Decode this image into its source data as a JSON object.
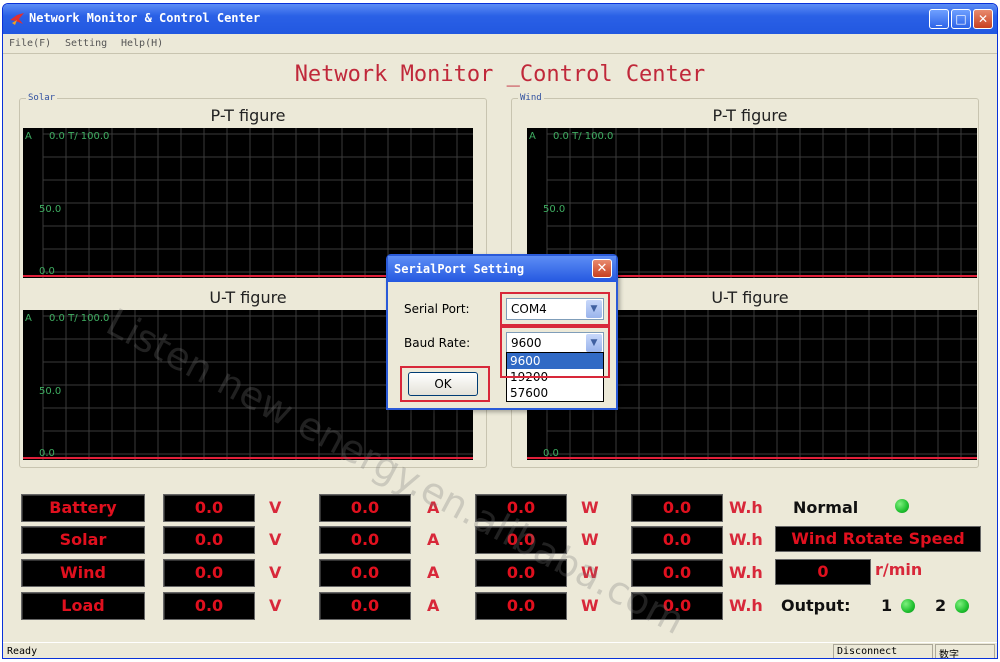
{
  "window": {
    "title": "Network Monitor & Control Center"
  },
  "menu": [
    "File(F)",
    "Setting",
    "Help(H)"
  ],
  "app_title": "Network Monitor _Control Center",
  "groups": {
    "solar": "Solar",
    "wind": "Wind"
  },
  "figures": {
    "pt_title": "P-T figure",
    "ut_title": "U-T figure",
    "axis_unit": "A",
    "readout": "0.0 T/  100.0",
    "tick_mid": "50.0",
    "tick_low": "0.0"
  },
  "dialog": {
    "title": "SerialPort Setting",
    "serial_port_label": "Serial Port:",
    "serial_port_value": "COM4",
    "baud_rate_label": "Baud Rate:",
    "baud_rate_value": "9600",
    "baud_options": [
      "9600",
      "19200",
      "57600"
    ],
    "ok_label": "OK"
  },
  "readings": {
    "rows": [
      {
        "label": "Battery",
        "v": "0.0",
        "a": "0.0",
        "w": "0.0",
        "wh": "0.0"
      },
      {
        "label": "Solar",
        "v": "0.0",
        "a": "0.0",
        "w": "0.0",
        "wh": "0.0"
      },
      {
        "label": "Wind",
        "v": "0.0",
        "a": "0.0",
        "w": "0.0",
        "wh": "0.0"
      },
      {
        "label": "Load",
        "v": "0.0",
        "a": "0.0",
        "w": "0.0",
        "wh": "0.0"
      }
    ],
    "units": {
      "v": "V",
      "a": "A",
      "w": "W",
      "wh": "W.h"
    }
  },
  "status": {
    "normal": "Normal",
    "wind_speed_label": "Wind Rotate Speed",
    "wind_speed_value": "0",
    "wind_speed_unit": "r/min",
    "output_label": "Output:",
    "output_1": "1",
    "output_2": "2",
    "led_color": "#1fbf2f"
  },
  "statusbar": {
    "left": "Ready",
    "conn": "Disconnect",
    "mode": "数字"
  },
  "watermark": "Listen new energy.en.alibaba.com",
  "colors": {
    "accent_red": "#c0283a",
    "plot_bg": "#000000",
    "grid": "#3a3a3a",
    "baseline": "#e0203a"
  }
}
